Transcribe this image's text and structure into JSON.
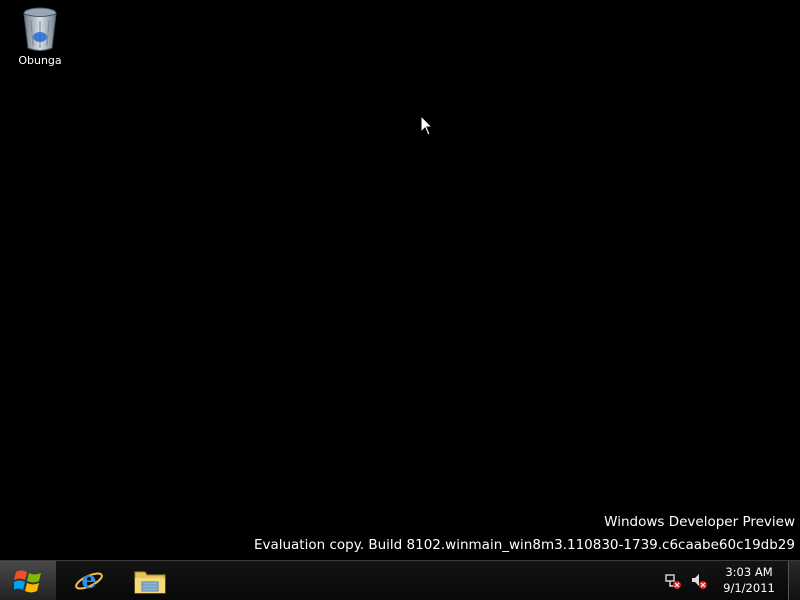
{
  "desktop": {
    "background_color": "#000000",
    "icons": [
      {
        "label": "Obunga",
        "icon": "recycle-bin-icon"
      }
    ]
  },
  "watermark": {
    "line1": "Windows Developer Preview",
    "line2": "Evaluation copy. Build 8102.winmain_win8m3.110830-1739.c6caabe60c19db29"
  },
  "taskbar": {
    "start_icon": "windows-logo-icon",
    "pinned": [
      {
        "name": "Internet Explorer",
        "icon": "internet-explorer-icon"
      },
      {
        "name": "Windows Explorer",
        "icon": "folder-icon"
      }
    ],
    "tray": {
      "network_icon": "network-disconnected-icon",
      "volume_icon": "volume-muted-icon",
      "time": "3:03 AM",
      "date": "9/1/2011"
    }
  }
}
